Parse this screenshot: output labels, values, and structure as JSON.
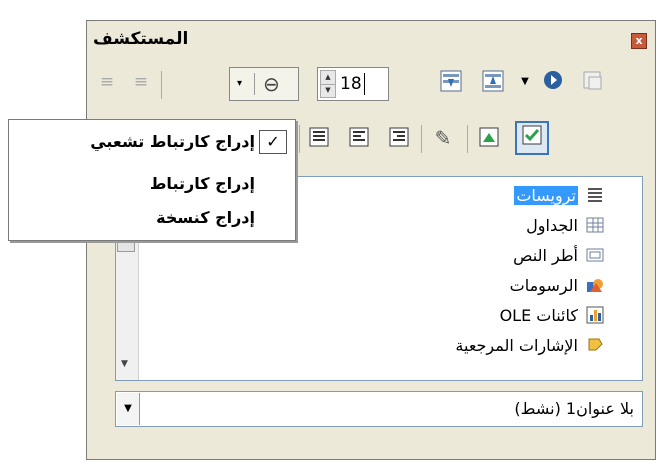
{
  "window": {
    "title": "المستكشف",
    "close_label": "x"
  },
  "toolbar": {
    "font_size_value": "18",
    "link_combo_arrow": "▾",
    "link_chain_symbol": "⊖"
  },
  "menu": {
    "items": [
      {
        "label": "إدراج كارتباط تشعبي",
        "checked": true
      },
      {
        "label": "إدراج كارتباط",
        "checked": false
      },
      {
        "label": "إدراج كنسخة",
        "checked": false
      }
    ],
    "check_symbol": "✓"
  },
  "navigator": {
    "items": [
      {
        "label": "ترويسات",
        "icon": "headings-icon",
        "selected": true
      },
      {
        "label": "الجداول",
        "icon": "tables-icon",
        "selected": false
      },
      {
        "label": "أطر النص",
        "icon": "text-frames-icon",
        "selected": false
      },
      {
        "label": "الرسومات",
        "icon": "graphics-icon",
        "selected": false
      },
      {
        "label": "كائنات OLE",
        "icon": "ole-objects-icon",
        "selected": false
      },
      {
        "label": "الإشارات المرجعية",
        "icon": "bookmarks-icon",
        "selected": false
      }
    ]
  },
  "document_select": {
    "value": "بلا عنوان1 (نشط)"
  },
  "colors": {
    "accent": "#3399ff",
    "window_bg": "#ece9d8",
    "active_border": "#3b74b8"
  }
}
